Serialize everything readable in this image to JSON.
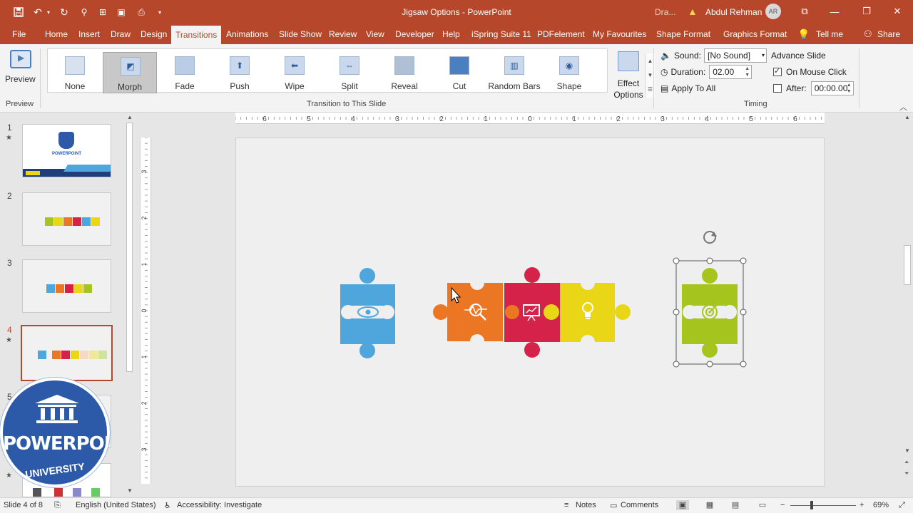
{
  "titlebar": {
    "title": "Jigsaw Options - PowerPoint",
    "draft_label": "Dra...",
    "user_name": "Abdul Rehman",
    "avatar_initials": "AR"
  },
  "tabs": [
    {
      "label": "File"
    },
    {
      "label": "Home"
    },
    {
      "label": "Insert"
    },
    {
      "label": "Draw"
    },
    {
      "label": "Design"
    },
    {
      "label": "Transitions"
    },
    {
      "label": "Animations"
    },
    {
      "label": "Slide Show"
    },
    {
      "label": "Review"
    },
    {
      "label": "View"
    },
    {
      "label": "Developer"
    },
    {
      "label": "Help"
    },
    {
      "label": "iSpring Suite 11"
    },
    {
      "label": "PDFelement"
    },
    {
      "label": "My Favourites"
    },
    {
      "label": "Shape Format"
    },
    {
      "label": "Graphics Format"
    },
    {
      "label": "Tell me"
    },
    {
      "label": "Share"
    }
  ],
  "ribbon": {
    "preview": {
      "label": "Preview",
      "group": "Preview"
    },
    "transitions": [
      {
        "label": "None",
        "icon": "none-transition-icon"
      },
      {
        "label": "Morph",
        "icon": "morph-transition-icon"
      },
      {
        "label": "Fade",
        "icon": "fade-transition-icon"
      },
      {
        "label": "Push",
        "icon": "push-transition-icon"
      },
      {
        "label": "Wipe",
        "icon": "wipe-transition-icon"
      },
      {
        "label": "Split",
        "icon": "split-transition-icon"
      },
      {
        "label": "Reveal",
        "icon": "reveal-transition-icon"
      },
      {
        "label": "Cut",
        "icon": "cut-transition-icon"
      },
      {
        "label": "Random Bars",
        "icon": "random-bars-transition-icon"
      },
      {
        "label": "Shape",
        "icon": "shape-transition-icon"
      }
    ],
    "selected_transition": "Morph",
    "effect_options": {
      "line1": "Effect",
      "line2": "Options"
    },
    "group_transition_label": "Transition to This Slide",
    "timing": {
      "sound_label": "Sound:",
      "sound_value": "[No Sound]",
      "duration_label": "Duration:",
      "duration_value": "02.00",
      "apply_all_label": "Apply To All",
      "advance_label": "Advance Slide",
      "on_mouse_click_label": "On Mouse Click",
      "on_mouse_click_checked": true,
      "after_label": "After:",
      "after_checked": false,
      "after_value": "00:00.00",
      "group_label": "Timing"
    }
  },
  "slides_panel": {
    "slides": [
      {
        "number": "1",
        "star": "★"
      },
      {
        "number": "2",
        "star": ""
      },
      {
        "number": "3",
        "star": ""
      },
      {
        "number": "4",
        "star": "★"
      },
      {
        "number": "5",
        "star": ""
      },
      {
        "number": "6",
        "star": "★"
      }
    ],
    "current": "4",
    "slide1_text": "POWERPOINT"
  },
  "logo": {
    "line1": "POWERPOINT",
    "line2": "UNIVERSITY"
  },
  "rulers": {
    "horizontal": [
      "6",
      "5",
      "4",
      "3",
      "2",
      "1",
      "0",
      "1",
      "2",
      "3",
      "4",
      "5",
      "6"
    ],
    "vertical": [
      "3",
      "2",
      "1",
      "0",
      "1",
      "2",
      "3"
    ]
  },
  "slide": {
    "colors": {
      "blue": "#4ea6dc",
      "orange": "#eb7624",
      "red": "#d42249",
      "yellow": "#e8d617",
      "green": "#a6c41e"
    },
    "pieces": [
      {
        "name": "blue-puzzle-piece",
        "icon": "eye-icon"
      },
      {
        "name": "orange-puzzle-piece",
        "icon": "search-chart-icon"
      },
      {
        "name": "red-puzzle-piece",
        "icon": "presentation-icon"
      },
      {
        "name": "yellow-puzzle-piece",
        "icon": "lightbulb-icon"
      },
      {
        "name": "green-puzzle-piece",
        "icon": "target-icon"
      }
    ]
  },
  "statusbar": {
    "slide_info": "Slide 4 of 8",
    "language": "English (United States)",
    "accessibility": "Accessibility: Investigate",
    "notes": "Notes",
    "comments": "Comments",
    "zoom": "69%",
    "zoom_minus": "−",
    "zoom_plus": "+"
  }
}
